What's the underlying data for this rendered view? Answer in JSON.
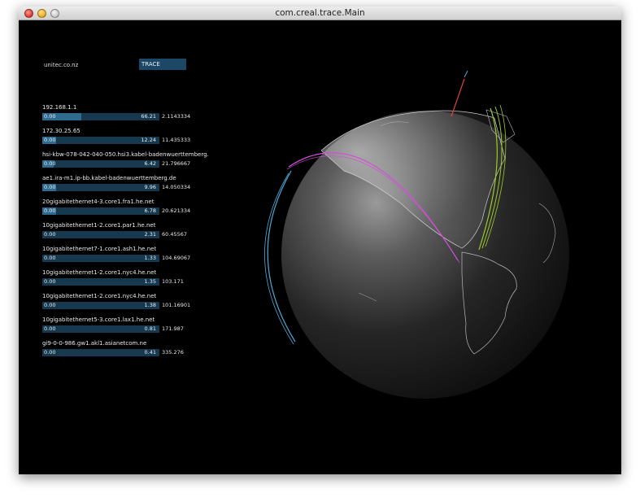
{
  "window": {
    "title": "com.creal.trace.Main"
  },
  "search": {
    "value": "unitec.co.nz",
    "button_label": "TRACE"
  },
  "hops": [
    {
      "host": "192.168.1.1",
      "min": "0.00",
      "max": "66.21",
      "time": "2.1143334",
      "fill": 0.33
    },
    {
      "host": "172.30.25.65",
      "min": "0.00",
      "max": "12.24",
      "time": "11.435333",
      "fill": 0.12
    },
    {
      "host": "hsi-kbw-078-042-040-050.hsi3.kabel-badenwuerttemberg.",
      "min": "0.00",
      "max": "6.42",
      "time": "21.796667",
      "fill": 0.1
    },
    {
      "host": "ae1.ira-m1.ip-bb.kabel-badenwuerttemberg.de",
      "min": "0.00",
      "max": "9.96",
      "time": "14.050334",
      "fill": 0.12
    },
    {
      "host": "20gigabitethernet4-3.core1.fra1.he.net",
      "min": "0.00",
      "max": "6.78",
      "time": "20.621334",
      "fill": 0.12
    },
    {
      "host": "10gigabitethernet1-2.core1.par1.he.net",
      "min": "0.00",
      "max": "2.31",
      "time": "60.45567",
      "fill": 0.0
    },
    {
      "host": "10gigabitethernet7-1.core1.ash1.he.net",
      "min": "0.00",
      "max": "1.33",
      "time": "104.69067",
      "fill": 0.0
    },
    {
      "host": "10gigabitethernet1-2.core1.nyc4.he.net",
      "min": "0.00",
      "max": "1.35",
      "time": "103.171",
      "fill": 0.0
    },
    {
      "host": "10gigabitethernet1-2.core1.nyc4.he.net",
      "min": "0.00",
      "max": "1.38",
      "time": "101.16901",
      "fill": 0.0
    },
    {
      "host": "10gigabitethernet5-3.core1.lax1.he.net",
      "min": "0.00",
      "max": "0.81",
      "time": "171.987",
      "fill": 0.0
    },
    {
      "host": "gi9-0-0-986.gw1.akl1.asianetcom.ne",
      "min": "0.00",
      "max": "0.41",
      "time": "335.276",
      "fill": 0.0
    }
  ],
  "colors": {
    "bar_bg": "#16394f",
    "bar_fill": "#2e6b8f",
    "trace_button": "#1c4766",
    "route_magenta": "#d24fd8",
    "route_green": "#9ccc2a",
    "route_blue": "#4aa8d8",
    "route_red": "#e04040"
  }
}
